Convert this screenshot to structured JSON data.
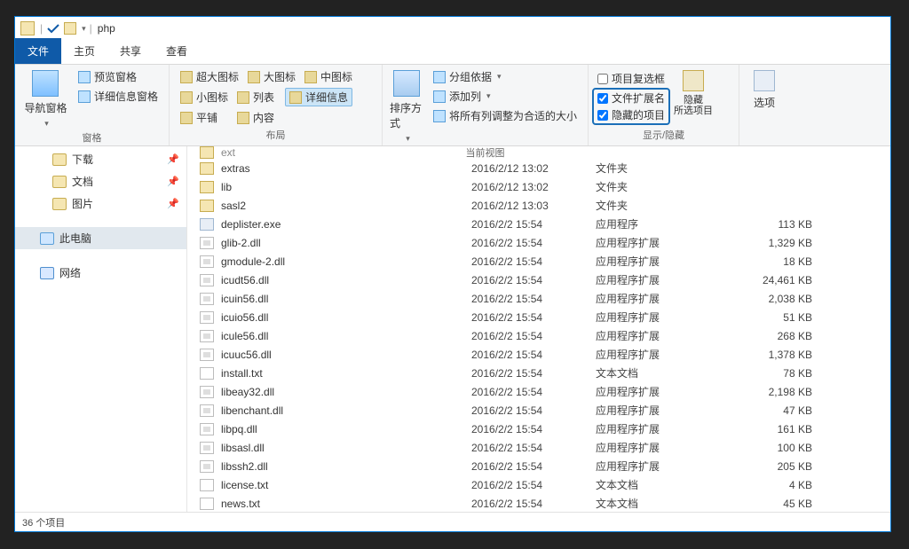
{
  "title": "php",
  "tabs": {
    "file": "文件",
    "home": "主页",
    "share": "共享",
    "view": "查看"
  },
  "ribbon": {
    "nav": "导航窗格",
    "preview": "预览窗格",
    "details": "详细信息窗格",
    "g_pane": "窗格",
    "xlarge": "超大图标",
    "large": "大图标",
    "medium": "中图标",
    "small": "小图标",
    "list": "列表",
    "detail": "详细信息",
    "tiles": "平铺",
    "content": "内容",
    "g_layout": "布局",
    "sort": "排序方式",
    "groupby": "分组依据",
    "addcol": "添加列",
    "autosize": "将所有列调整为合适的大小",
    "g_view": "当前视图",
    "itemcb": "项目复选框",
    "ext": "文件扩展名",
    "hidden": "隐藏的项目",
    "hidebtn": "隐藏",
    "hidebtn2": "所选项目",
    "g_show": "显示/隐藏",
    "options": "选项"
  },
  "nav": {
    "downloads": "下载",
    "docs": "文档",
    "pics": "图片",
    "thispc": "此电脑",
    "network": "网络"
  },
  "cols": {
    "truncated_date": "2016/2/12 13:02",
    "truncated_type": "文件夹"
  },
  "files": [
    {
      "name": "ext",
      "date": "",
      "type": "",
      "size": "",
      "icon": "folder",
      "cut": true
    },
    {
      "name": "extras",
      "date": "2016/2/12 13:02",
      "type": "文件夹",
      "size": "",
      "icon": "folder"
    },
    {
      "name": "lib",
      "date": "2016/2/12 13:02",
      "type": "文件夹",
      "size": "",
      "icon": "folder"
    },
    {
      "name": "sasl2",
      "date": "2016/2/12 13:03",
      "type": "文件夹",
      "size": "",
      "icon": "folder"
    },
    {
      "name": "deplister.exe",
      "date": "2016/2/2 15:54",
      "type": "应用程序",
      "size": "113 KB",
      "icon": "exe"
    },
    {
      "name": "glib-2.dll",
      "date": "2016/2/2 15:54",
      "type": "应用程序扩展",
      "size": "1,329 KB",
      "icon": "dll"
    },
    {
      "name": "gmodule-2.dll",
      "date": "2016/2/2 15:54",
      "type": "应用程序扩展",
      "size": "18 KB",
      "icon": "dll"
    },
    {
      "name": "icudt56.dll",
      "date": "2016/2/2 15:54",
      "type": "应用程序扩展",
      "size": "24,461 KB",
      "icon": "dll"
    },
    {
      "name": "icuin56.dll",
      "date": "2016/2/2 15:54",
      "type": "应用程序扩展",
      "size": "2,038 KB",
      "icon": "dll"
    },
    {
      "name": "icuio56.dll",
      "date": "2016/2/2 15:54",
      "type": "应用程序扩展",
      "size": "51 KB",
      "icon": "dll"
    },
    {
      "name": "icule56.dll",
      "date": "2016/2/2 15:54",
      "type": "应用程序扩展",
      "size": "268 KB",
      "icon": "dll"
    },
    {
      "name": "icuuc56.dll",
      "date": "2016/2/2 15:54",
      "type": "应用程序扩展",
      "size": "1,378 KB",
      "icon": "dll"
    },
    {
      "name": "install.txt",
      "date": "2016/2/2 15:54",
      "type": "文本文档",
      "size": "78 KB",
      "icon": "txt"
    },
    {
      "name": "libeay32.dll",
      "date": "2016/2/2 15:54",
      "type": "应用程序扩展",
      "size": "2,198 KB",
      "icon": "dll"
    },
    {
      "name": "libenchant.dll",
      "date": "2016/2/2 15:54",
      "type": "应用程序扩展",
      "size": "47 KB",
      "icon": "dll"
    },
    {
      "name": "libpq.dll",
      "date": "2016/2/2 15:54",
      "type": "应用程序扩展",
      "size": "161 KB",
      "icon": "dll"
    },
    {
      "name": "libsasl.dll",
      "date": "2016/2/2 15:54",
      "type": "应用程序扩展",
      "size": "100 KB",
      "icon": "dll"
    },
    {
      "name": "libssh2.dll",
      "date": "2016/2/2 15:54",
      "type": "应用程序扩展",
      "size": "205 KB",
      "icon": "dll"
    },
    {
      "name": "license.txt",
      "date": "2016/2/2 15:54",
      "type": "文本文档",
      "size": "4 KB",
      "icon": "txt"
    },
    {
      "name": "news.txt",
      "date": "2016/2/2 15:54",
      "type": "文本文档",
      "size": "45 KB",
      "icon": "txt"
    }
  ],
  "status": "36 个项目"
}
